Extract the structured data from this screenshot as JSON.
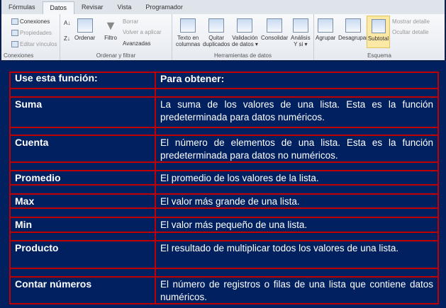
{
  "ribbon": {
    "tabs": [
      "Fórmulas",
      "Datos",
      "Revisar",
      "Vista",
      "Programador"
    ],
    "active_tab": "Datos",
    "groups": {
      "conexiones": {
        "label": "Conexiones",
        "items": [
          "Conexiones",
          "Propiedades",
          "Editar vínculos"
        ]
      },
      "ordenar": {
        "label": "Ordenar y filtrar",
        "ordenar": "Ordenar",
        "filtro": "Filtro",
        "borrar": "Borrar",
        "volver": "Volver a aplicar",
        "avanzadas": "Avanzadas"
      },
      "herramientas": {
        "label": "Herramientas de datos",
        "texto1": "Texto en",
        "texto2": "columnas",
        "quitar1": "Quitar",
        "quitar2": "duplicados",
        "valid1": "Validación",
        "valid2": "de datos ▾",
        "consolidar": "Consolidar",
        "analisis1": "Análisis",
        "analisis2": "Y si ▾"
      },
      "esquema": {
        "label": "Esquema",
        "agrupar": "Agrupar",
        "desagrupar": "Desagrupar",
        "subtotal": "Subtotal",
        "mostrar": "Mostrar detalle",
        "ocultar": "Ocultar detalle"
      }
    }
  },
  "table": {
    "headers": [
      "Use esta función:",
      "Para obtener:"
    ],
    "rows": [
      {
        "func": "Suma",
        "desc": "La suma de los valores de una lista. Esta es la función predeterminada para datos numéricos."
      },
      {
        "func": "Cuenta",
        "desc": "El número de elementos de una lista. Esta es la función predeterminada para datos no numéricos."
      },
      {
        "func": "Promedio",
        "desc": "El promedio de los valores de la lista."
      },
      {
        "func": "Max",
        "desc": "El valor más grande de una lista."
      },
      {
        "func": "Min",
        "desc": "El valor más pequeño de una lista."
      },
      {
        "func": "Producto",
        "desc": "El resultado de multiplicar todos los valores de una lista."
      },
      {
        "func": "Contar números",
        "desc": "El número de registros o filas de una lista que contiene datos numéricos."
      }
    ]
  },
  "colors": {
    "background": "#002060",
    "border": "#c00000"
  }
}
